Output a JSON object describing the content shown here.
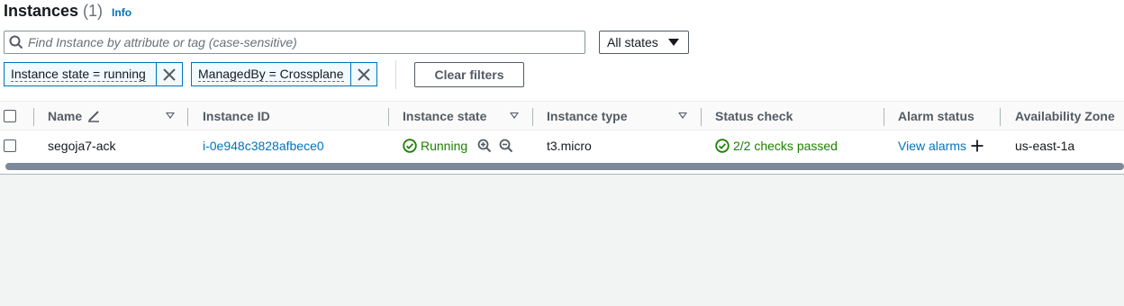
{
  "header": {
    "title": "Instances",
    "count": "(1)",
    "info_label": "Info"
  },
  "search": {
    "placeholder": "Find Instance by attribute or tag (case-sensitive)",
    "value": ""
  },
  "state_filter": {
    "selected": "All states"
  },
  "tokens": [
    {
      "label": "Instance state = running"
    },
    {
      "label": "ManagedBy = Crossplane"
    }
  ],
  "clear_filters_label": "Clear filters",
  "table": {
    "columns": [
      "Name",
      "Instance ID",
      "Instance state",
      "Instance type",
      "Status check",
      "Alarm status",
      "Availability Zone"
    ],
    "rows": [
      {
        "name": "segoja7-ack",
        "instance_id": "i-0e948c3828afbece0",
        "state": "Running",
        "type": "t3.micro",
        "status_check": "2/2 checks passed",
        "alarm_status": "View alarms",
        "az": "us-east-1a"
      }
    ]
  },
  "colors": {
    "link": "#0073bb",
    "success": "#1d8102",
    "border": "#aab7b8"
  },
  "icons": [
    "search-icon",
    "close-icon",
    "edit-icon",
    "success-icon",
    "zoom-in-icon",
    "zoom-out-icon",
    "plus-icon",
    "caret-down-icon"
  ]
}
